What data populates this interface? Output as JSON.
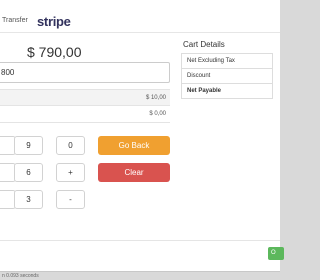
{
  "tabs": {
    "transfer_label": "Transfer",
    "stripe_label": "stripe"
  },
  "payment": {
    "amount": "$ 790,00",
    "input_value": "800",
    "summary_values": [
      "$ 10,00",
      "$ 0,00"
    ]
  },
  "keypad": {
    "keys": [
      "9",
      "0",
      "6",
      "+",
      "3",
      "-"
    ],
    "go_back_label": "Go Back",
    "clear_label": "Clear"
  },
  "cart": {
    "title": "Cart Details",
    "rows": [
      "Net Excluding Tax",
      "Discount",
      "Net Payable"
    ]
  },
  "footer": {
    "ok_label": "O",
    "status_text": "n 0.093 seconds"
  },
  "colors": {
    "go_back": "#f0a030",
    "clear": "#d9534f",
    "ok": "#5cb85c"
  }
}
